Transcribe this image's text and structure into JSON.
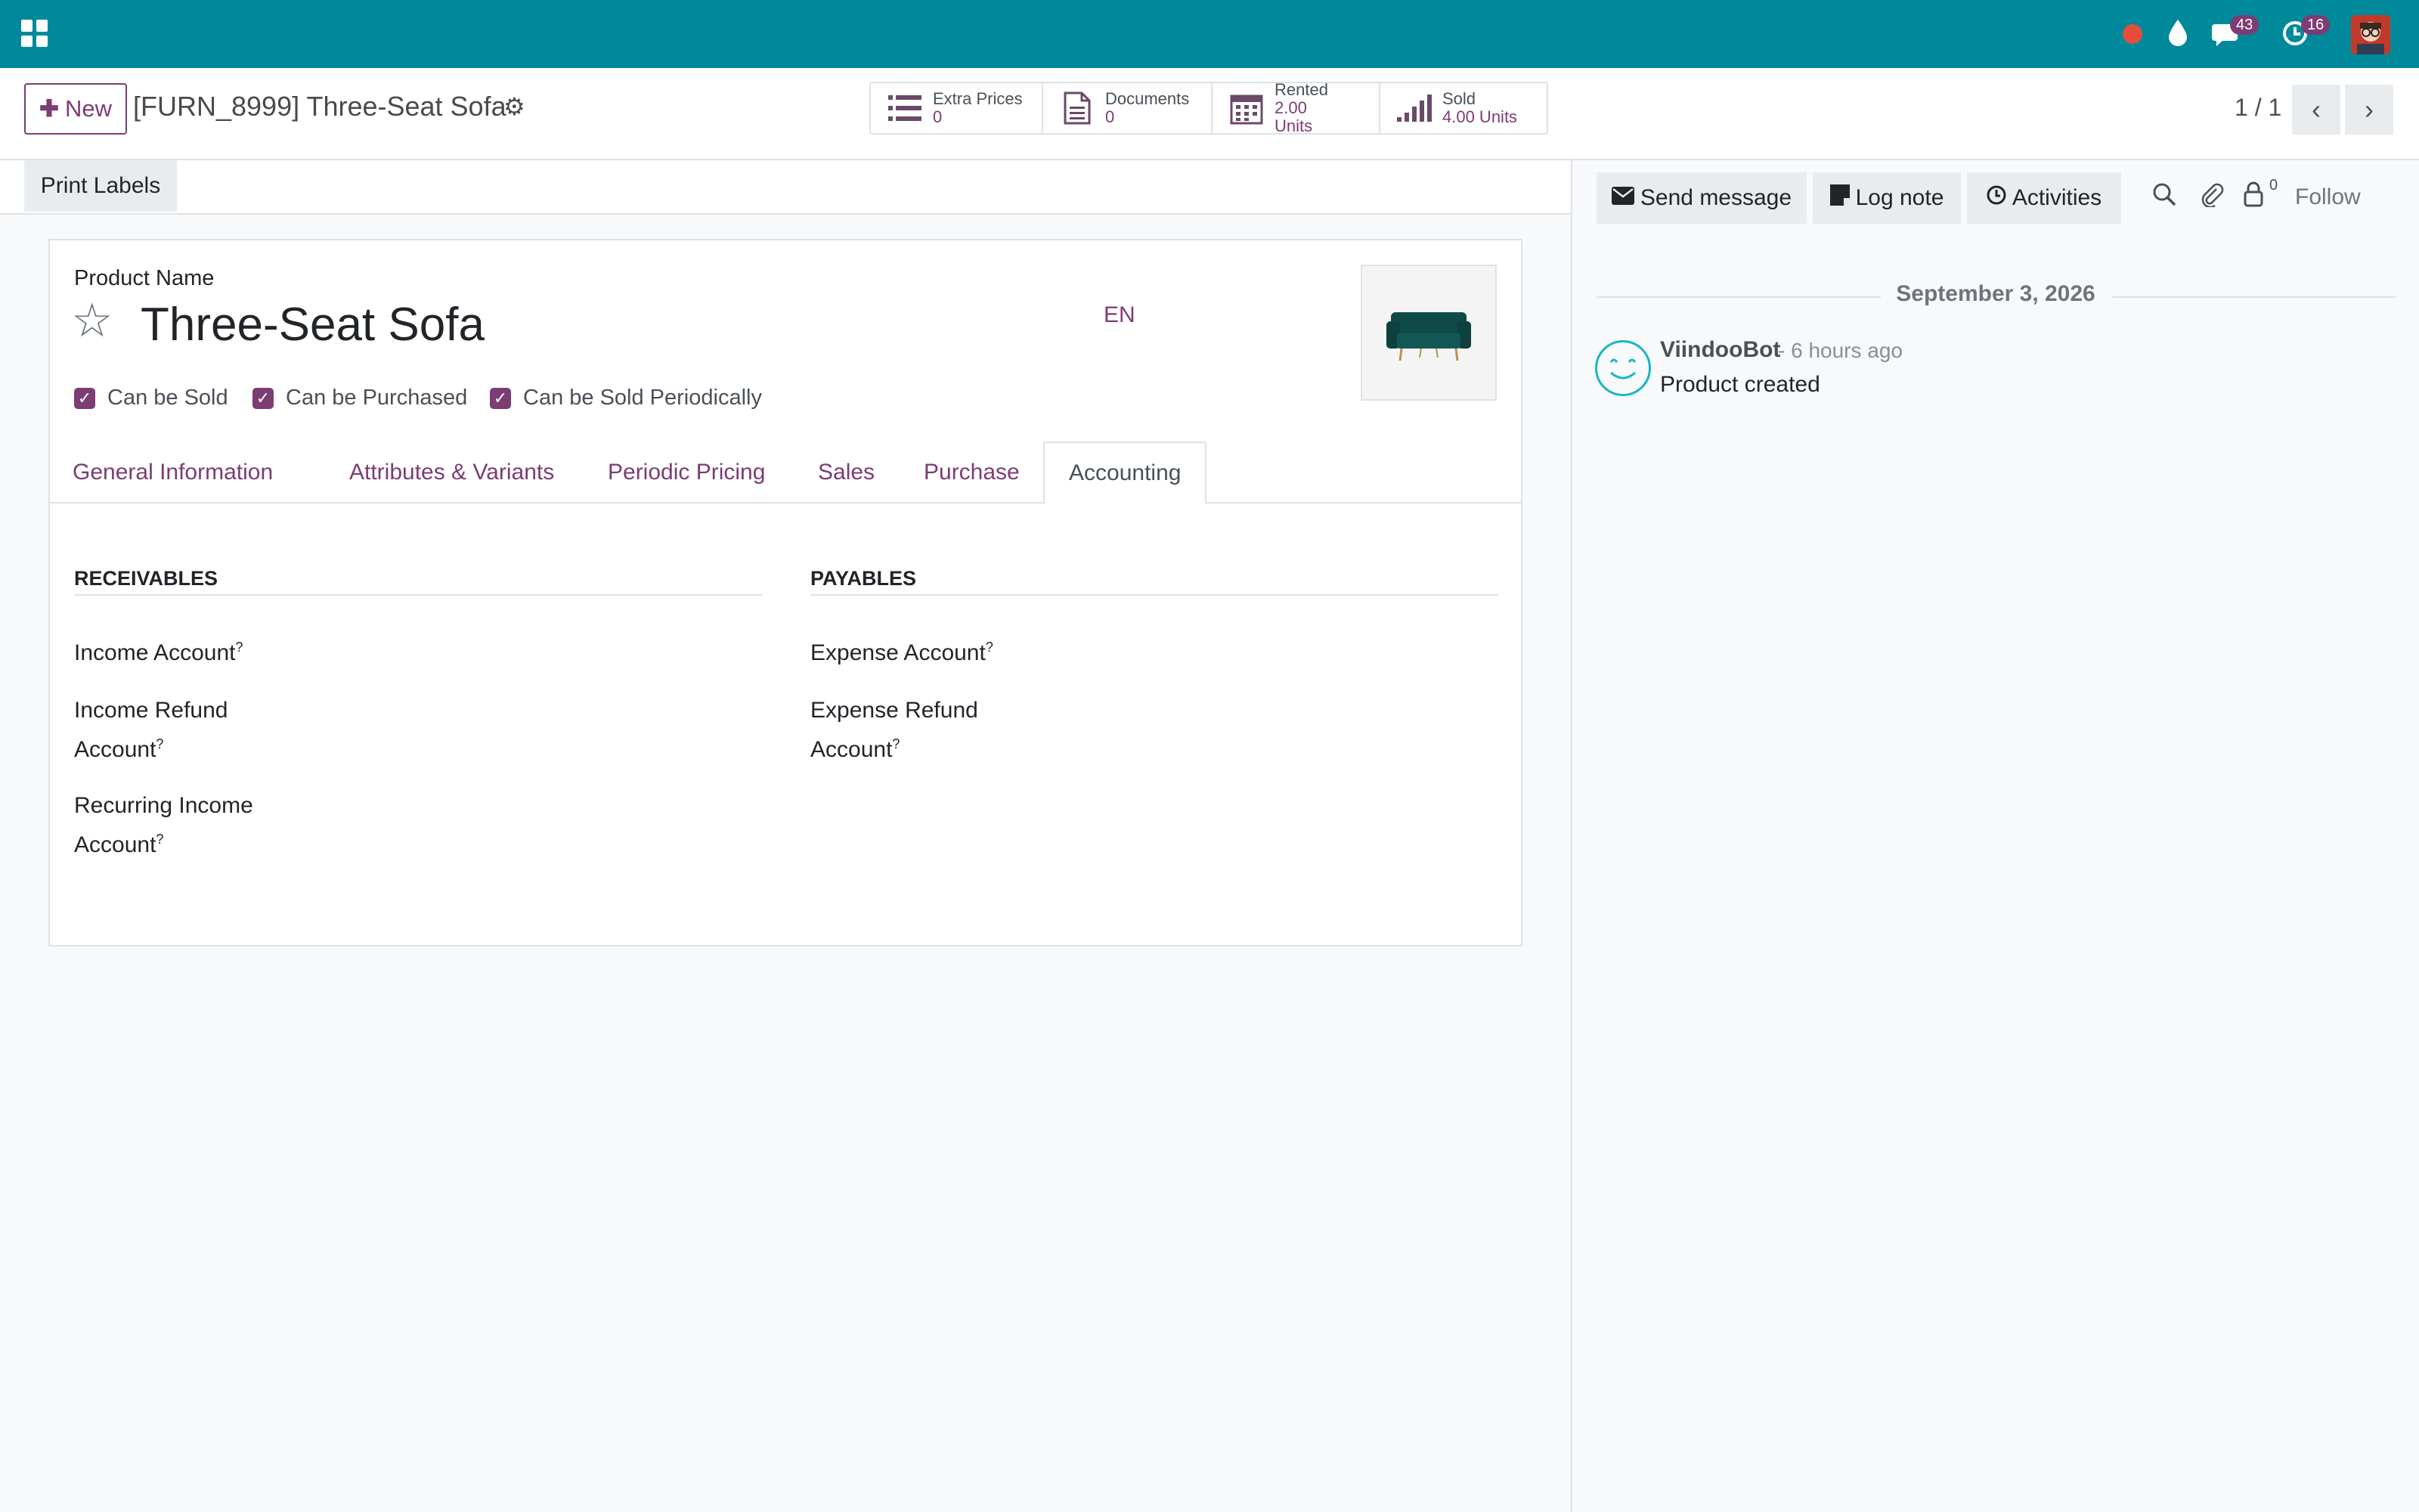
{
  "topbar": {
    "messages_count": "43",
    "activities_count": "16"
  },
  "control_panel": {
    "new_label": "New",
    "breadcrumb": "[FURN_8999] Three-Seat Sofa",
    "stat_buttons": [
      {
        "label": "Extra Prices",
        "value": "0",
        "icon": "list-icon"
      },
      {
        "label": "Documents",
        "value": "0",
        "icon": "document-icon"
      },
      {
        "label": "Rented",
        "value": "2.00",
        "value2": "Units",
        "icon": "calendar-icon"
      },
      {
        "label": "Sold",
        "value": "4.00 Units",
        "icon": "signal-bars-icon"
      }
    ],
    "pager": "1 / 1"
  },
  "form": {
    "print_labels": "Print Labels",
    "product_name_label": "Product Name",
    "product_name": "Three-Seat Sofa",
    "lang": "EN",
    "checkboxes": [
      {
        "label": "Can be Sold",
        "checked": true
      },
      {
        "label": "Can be Purchased",
        "checked": true
      },
      {
        "label": "Can be Sold Periodically",
        "checked": true
      }
    ],
    "tabs": [
      "General Information",
      "Attributes & Variants",
      "Periodic Pricing",
      "Sales",
      "Purchase",
      "Accounting"
    ],
    "active_tab": "Accounting",
    "receivables": {
      "title": "RECEIVABLES",
      "income_account": "Income Account",
      "income_refund_1": "Income Refund",
      "income_refund_2": "Account",
      "recurring_1": "Recurring Income",
      "recurring_2": "Account"
    },
    "payables": {
      "title": "PAYABLES",
      "expense_account": "Expense Account",
      "expense_refund_1": "Expense Refund",
      "expense_refund_2": "Account"
    },
    "help_mark": "?"
  },
  "chatter": {
    "send_message": "Send message",
    "log_note": "Log note",
    "activities": "Activities",
    "followers_count": "0",
    "follow": "Follow",
    "date": "September 3, 2026",
    "message": {
      "author": "ViindooBot",
      "time": "- 6 hours ago",
      "body": "Product created"
    }
  },
  "colors": {
    "topbar": "#00899a",
    "accent": "#7c3c74"
  }
}
